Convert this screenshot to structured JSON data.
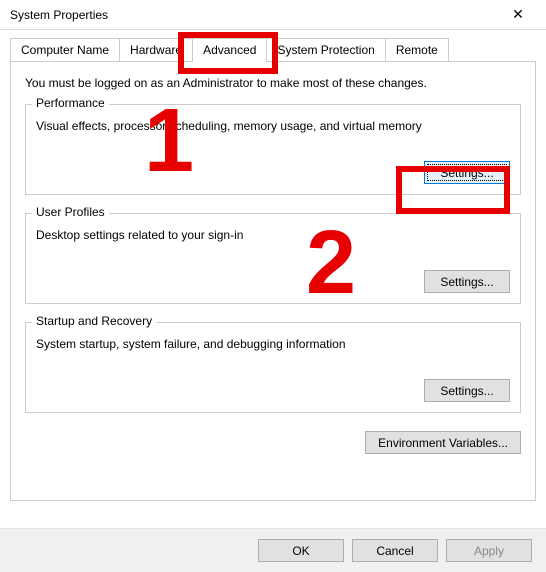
{
  "window": {
    "title": "System Properties",
    "close_glyph": "✕"
  },
  "tabs": {
    "t0": "Computer Name",
    "t1": "Hardware",
    "t2": "Advanced",
    "t3": "System Protection",
    "t4": "Remote"
  },
  "page": {
    "admin_note": "You must be logged on as an Administrator to make most of these changes."
  },
  "groups": {
    "performance": {
      "title": "Performance",
      "desc": "Visual effects, processor scheduling, memory usage, and virtual memory",
      "button": "Settings..."
    },
    "user_profiles": {
      "title": "User Profiles",
      "desc": "Desktop settings related to your sign-in",
      "button": "Settings..."
    },
    "startup": {
      "title": "Startup and Recovery",
      "desc": "System startup, system failure, and debugging information",
      "button": "Settings..."
    }
  },
  "env_button": "Environment Variables...",
  "footer": {
    "ok": "OK",
    "cancel": "Cancel",
    "apply": "Apply"
  },
  "annotations": {
    "n1": "1",
    "n2": "2",
    "highlight_color": "#e60000"
  }
}
